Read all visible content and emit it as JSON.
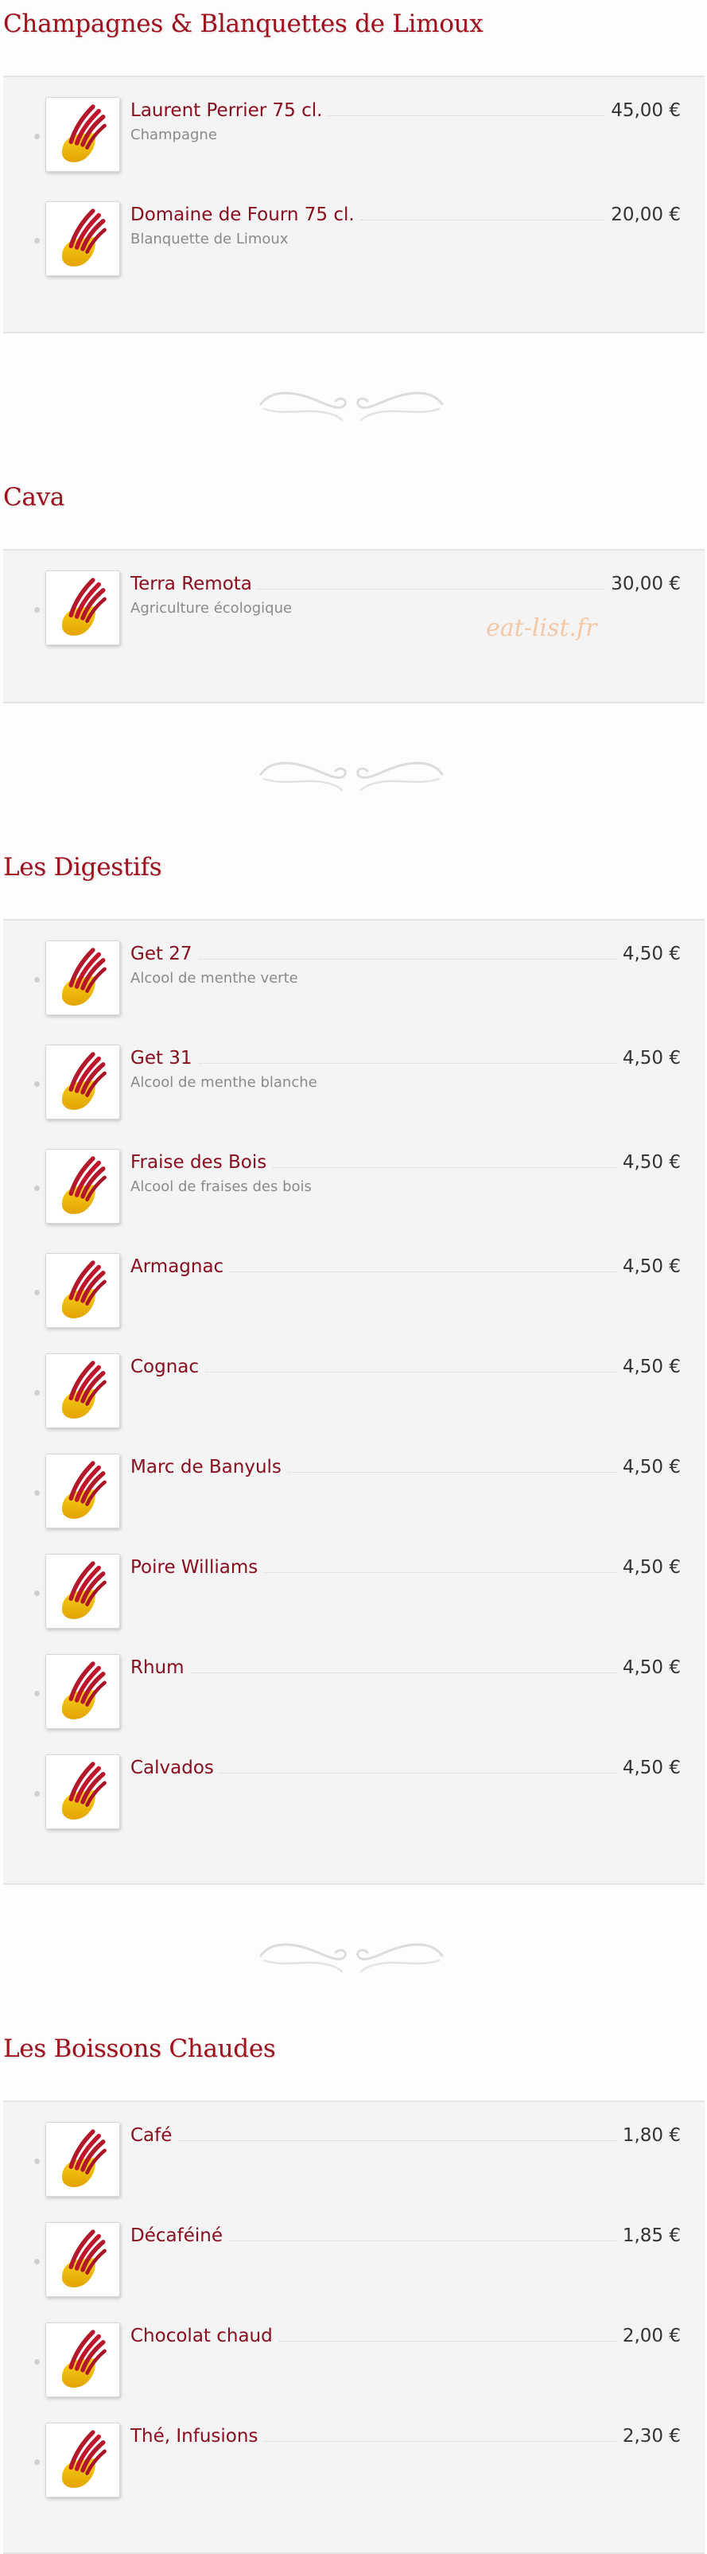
{
  "sections": [
    {
      "title": "Champagnes & Blanquettes de Limoux",
      "items": [
        {
          "name": "Laurent Perrier 75 cl.",
          "price": "45,00 €",
          "desc": "Champagne"
        },
        {
          "name": "Domaine de Fourn 75 cl.",
          "price": "20,00 €",
          "desc": "Blanquette de Limoux"
        }
      ]
    },
    {
      "title": "Cava",
      "items": [
        {
          "name": "Terra Remota",
          "price": "30,00 €",
          "desc": "Agriculture écologique"
        }
      ]
    },
    {
      "title": "Les Digestifs",
      "items": [
        {
          "name": "Get 27",
          "price": "4,50 €",
          "desc": "Alcool de menthe verte"
        },
        {
          "name": "Get 31",
          "price": "4,50 €",
          "desc": "Alcool de menthe blanche"
        },
        {
          "name": "Fraise des Bois",
          "price": "4,50 €",
          "desc": "Alcool de fraises des bois"
        },
        {
          "name": "Armagnac",
          "price": "4,50 €"
        },
        {
          "name": "Cognac",
          "price": "4,50 €"
        },
        {
          "name": "Marc de Banyuls",
          "price": "4,50 €"
        },
        {
          "name": "Poire Williams",
          "price": "4,50 €"
        },
        {
          "name": "Rhum",
          "price": "4,50 €"
        },
        {
          "name": "Calvados",
          "price": "4,50 €"
        }
      ]
    },
    {
      "title": "Les Boissons Chaudes",
      "items": [
        {
          "name": "Café",
          "price": "1,80 €"
        },
        {
          "name": "Décaféiné",
          "price": "1,85 €"
        },
        {
          "name": "Chocolat chaud",
          "price": "2,00 €"
        },
        {
          "name": "Thé, Infusions",
          "price": "2,30 €"
        }
      ]
    }
  ],
  "watermark": "eat-list.fr",
  "colors": {
    "title": "#a0111e",
    "item_name": "#8a1020",
    "price": "#333333",
    "desc": "#8a8a8a",
    "panel": "#f4f4f4"
  }
}
